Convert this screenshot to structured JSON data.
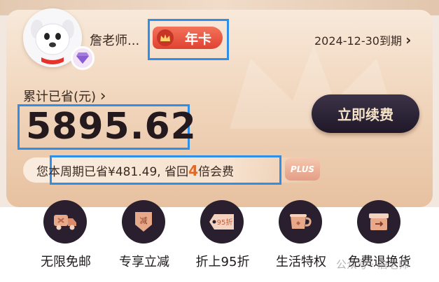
{
  "membership": {
    "username": "詹老师...",
    "badge_label": "年卡",
    "expiry": "2024-12-30到期",
    "expiry_arrow": "›"
  },
  "savings": {
    "label": "累计已省(元)",
    "label_arrow": "›",
    "amount": "5895.62"
  },
  "renew_button_label": "立即续费",
  "period": {
    "prefix": "您本周期已省¥481.49, 省回",
    "multiplier": "4",
    "suffix": "倍会费",
    "plus_label": "PLUS"
  },
  "features": [
    {
      "label": "无限免邮",
      "icon": "truck-icon"
    },
    {
      "label": "专享立减",
      "icon": "discount-tag-icon"
    },
    {
      "label": "折上95折",
      "icon": "95-off-tag-icon"
    },
    {
      "label": "生活特权",
      "icon": "cup-icon"
    },
    {
      "label": "免费退换货",
      "icon": "return-box-icon"
    }
  ],
  "watermark": "公众号 · 詹老师",
  "colors": {
    "accent": "#e04232",
    "highlight": "#e8671e",
    "dark_button": "#2a1f2e",
    "annotation_box": "#2f8fe8"
  }
}
